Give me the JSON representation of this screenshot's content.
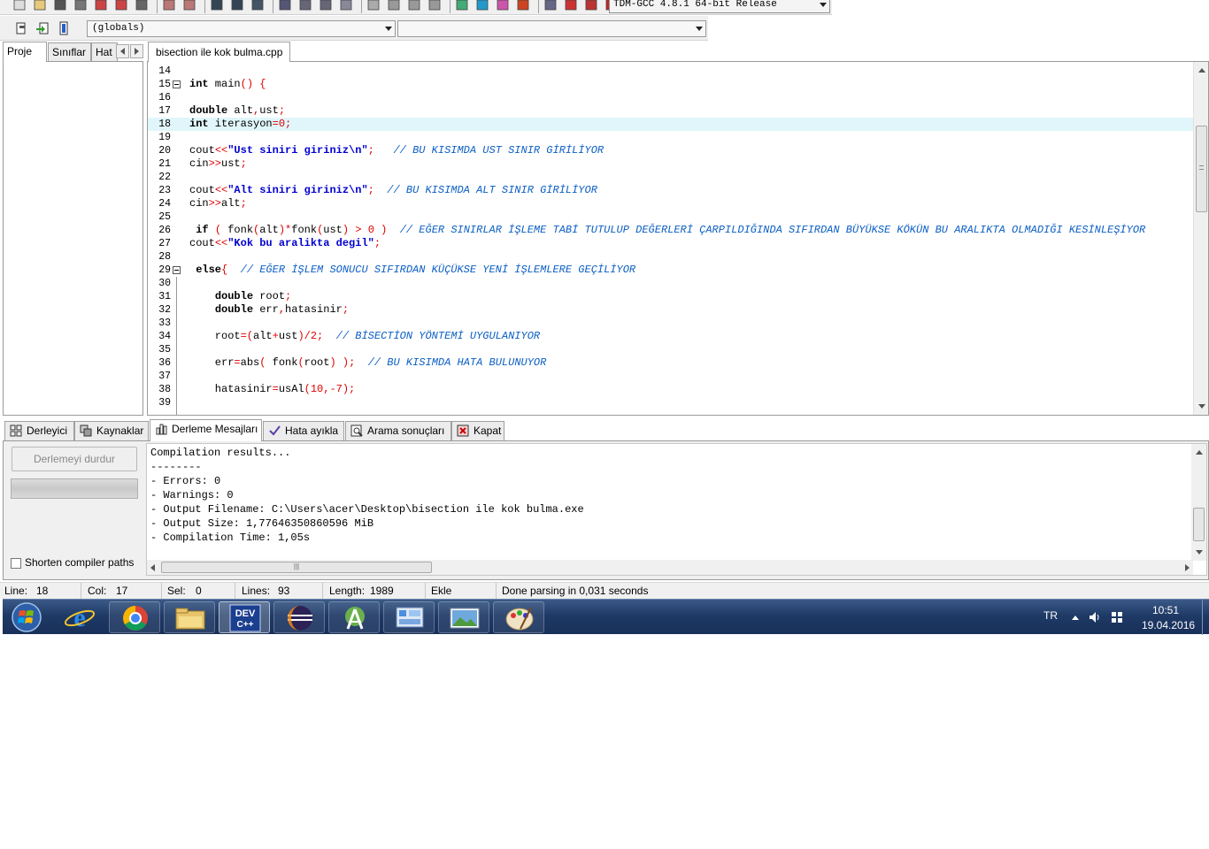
{
  "colors": {
    "keyword": "#000000",
    "operator": "#e00000",
    "string": "#0000d0",
    "comment": "#0b5fc4",
    "highlight_line": "#e0f6fb",
    "taskbar": "#1f3a66"
  },
  "toolbar": {
    "icons": [
      "new-file-icon",
      "open-icon",
      "save-icon",
      "save-all-icon",
      "close-icon",
      "close-all-icon",
      "print-icon",
      "undo-icon",
      "redo-icon",
      "find-icon",
      "replace-icon",
      "goto-icon",
      "bookmark-icon",
      "indent-icon",
      "unindent-icon",
      "toggle-comment-icon",
      "new-project-icon",
      "add-file-icon",
      "remove-file-icon",
      "project-options-icon",
      "compile-icon",
      "run-icon",
      "compile-run-icon",
      "rebuild-icon",
      "syntax-check-icon",
      "stop-icon",
      "profile-icon",
      "delete-profile-icon"
    ],
    "compiler_select": "TDM-GCC 4.8.1 64-bit Release",
    "scope_select": "(globals)",
    "function_select": ""
  },
  "left_panel": {
    "tabs": [
      {
        "label": "Proje",
        "active": true
      },
      {
        "label": "Sınıflar",
        "active": false
      },
      {
        "label": "Hat",
        "active": false
      }
    ]
  },
  "editor": {
    "file_tab": "bisection ile kok bulma.cpp",
    "lines": [
      {
        "n": "14",
        "code": []
      },
      {
        "n": "15",
        "fold": true,
        "code": [
          [
            "kw",
            "int"
          ],
          [
            "",
            " main"
          ],
          [
            "op",
            "() {"
          ]
        ]
      },
      {
        "n": "16",
        "code": []
      },
      {
        "n": "17",
        "code": [
          [
            "kw",
            "double"
          ],
          [
            "",
            " alt"
          ],
          [
            "op",
            ","
          ],
          [
            "",
            "ust"
          ],
          [
            "op",
            ";"
          ]
        ]
      },
      {
        "n": "18",
        "hl": true,
        "code": [
          [
            "kw",
            "int"
          ],
          [
            "",
            " iterasyon"
          ],
          [
            "op",
            "="
          ],
          [
            "num",
            "0"
          ],
          [
            "op",
            ";"
          ]
        ]
      },
      {
        "n": "19",
        "code": []
      },
      {
        "n": "20",
        "code": [
          [
            "",
            "cout"
          ],
          [
            "op",
            "<<"
          ],
          [
            "str",
            "\"Ust siniri giriniz\\n\""
          ],
          [
            "op",
            ";"
          ],
          [
            "",
            "   "
          ],
          [
            "cmt",
            "// BU KISIMDA UST SINIR GİRİLİYOR"
          ]
        ]
      },
      {
        "n": "21",
        "code": [
          [
            "",
            "cin"
          ],
          [
            "op",
            ">>"
          ],
          [
            "",
            "ust"
          ],
          [
            "op",
            ";"
          ]
        ]
      },
      {
        "n": "22",
        "code": []
      },
      {
        "n": "23",
        "code": [
          [
            "",
            "cout"
          ],
          [
            "op",
            "<<"
          ],
          [
            "str",
            "\"Alt siniri giriniz\\n\""
          ],
          [
            "op",
            ";"
          ],
          [
            "",
            "  "
          ],
          [
            "cmt",
            "// BU KISIMDA ALT SINIR GİRİLİYOR"
          ]
        ]
      },
      {
        "n": "24",
        "code": [
          [
            "",
            "cin"
          ],
          [
            "op",
            ">>"
          ],
          [
            "",
            "alt"
          ],
          [
            "op",
            ";"
          ]
        ]
      },
      {
        "n": "25",
        "code": []
      },
      {
        "n": "26",
        "code": [
          [
            "",
            ""
          ],
          [
            "kw",
            " if"
          ],
          [
            "",
            " "
          ],
          [
            "op",
            "("
          ],
          [
            "",
            " fonk"
          ],
          [
            "op",
            "("
          ],
          [
            "",
            "alt"
          ],
          [
            "op",
            ")*"
          ],
          [
            "",
            "fonk"
          ],
          [
            "op",
            "("
          ],
          [
            "",
            "ust"
          ],
          [
            "op",
            ")"
          ],
          [
            "",
            " "
          ],
          [
            "op",
            ">"
          ],
          [
            "",
            " "
          ],
          [
            "num",
            "0"
          ],
          [
            "",
            " "
          ],
          [
            "op",
            ")"
          ],
          [
            "",
            "  "
          ],
          [
            "cmt",
            "// EĞER SINIRLAR İŞLEME TABİ TUTULUP DEĞERLERİ ÇARPILDIĞINDA SIFIRDAN BÜYÜKSE KÖKÜN BU ARALIKTA OLMADIĞI KESİNLEŞİYOR"
          ]
        ]
      },
      {
        "n": "27",
        "code": [
          [
            "",
            "cout"
          ],
          [
            "op",
            "<<"
          ],
          [
            "str",
            "\"Kok bu aralikta degil\""
          ],
          [
            "op",
            ";"
          ]
        ]
      },
      {
        "n": "28",
        "code": []
      },
      {
        "n": "29",
        "fold": true,
        "code": [
          [
            "kw",
            " else"
          ],
          [
            "op",
            "{"
          ],
          [
            "",
            "  "
          ],
          [
            "cmt",
            "// EĞER İŞLEM SONUCU SIFIRDAN KÜÇÜKSE YENİ İŞLEMLERE GEÇİLİYOR"
          ]
        ]
      },
      {
        "n": "30",
        "code": []
      },
      {
        "n": "31",
        "code": [
          [
            "",
            "    "
          ],
          [
            "kw",
            "double"
          ],
          [
            "",
            " root"
          ],
          [
            "op",
            ";"
          ]
        ]
      },
      {
        "n": "32",
        "code": [
          [
            "",
            "    "
          ],
          [
            "kw",
            "double"
          ],
          [
            "",
            " err"
          ],
          [
            "op",
            ","
          ],
          [
            "",
            "hatasinir"
          ],
          [
            "op",
            ";"
          ]
        ]
      },
      {
        "n": "33",
        "code": []
      },
      {
        "n": "34",
        "code": [
          [
            "",
            "    root"
          ],
          [
            "op",
            "=("
          ],
          [
            "",
            "alt"
          ],
          [
            "op",
            "+"
          ],
          [
            "",
            "ust"
          ],
          [
            "op",
            ")/"
          ],
          [
            "num",
            "2"
          ],
          [
            "op",
            ";"
          ],
          [
            "",
            "  "
          ],
          [
            "cmt",
            "// BİSECTİON YÖNTEMİ UYGULANIYOR"
          ]
        ]
      },
      {
        "n": "35",
        "code": []
      },
      {
        "n": "36",
        "code": [
          [
            "",
            "    err"
          ],
          [
            "op",
            "="
          ],
          [
            "",
            "abs"
          ],
          [
            "op",
            "("
          ],
          [
            "",
            " fonk"
          ],
          [
            "op",
            "("
          ],
          [
            "",
            "root"
          ],
          [
            "op",
            ")"
          ],
          [
            "",
            " "
          ],
          [
            "op",
            ");"
          ],
          [
            "",
            "  "
          ],
          [
            "cmt",
            "// BU KISIMDA HATA BULUNUYOR"
          ]
        ]
      },
      {
        "n": "37",
        "code": []
      },
      {
        "n": "38",
        "code": [
          [
            "",
            "    hatasinir"
          ],
          [
            "op",
            "="
          ],
          [
            "",
            "usAl"
          ],
          [
            "op",
            "("
          ],
          [
            "num",
            "10"
          ],
          [
            "op",
            ",-"
          ],
          [
            "num",
            "7"
          ],
          [
            "op",
            ");"
          ]
        ]
      },
      {
        "n": "39",
        "code": []
      }
    ]
  },
  "bottom_tabs": [
    {
      "label": "Derleyici",
      "icon": "compiler-grid-icon",
      "active": false
    },
    {
      "label": "Kaynaklar",
      "icon": "resources-icon",
      "active": false
    },
    {
      "label": "Derleme Mesajları",
      "icon": "compile-log-chart-icon",
      "active": true
    },
    {
      "label": "Hata ayıkla",
      "icon": "debug-check-icon",
      "active": false
    },
    {
      "label": "Arama sonuçları",
      "icon": "search-results-icon",
      "active": false
    },
    {
      "label": "Kapat",
      "icon": "close-panel-icon",
      "active": false
    }
  ],
  "compile_panel": {
    "stop_button": "Derlemeyi durdur",
    "shorten_label": "Shorten compiler paths",
    "output": [
      "Compilation results...",
      "--------",
      "- Errors: 0",
      "- Warnings: 0",
      "- Output Filename: C:\\Users\\acer\\Desktop\\bisection ile kok bulma.exe",
      "- Output Size: 1,77646350860596 MiB",
      "- Compilation Time: 1,05s"
    ]
  },
  "status": {
    "line_label": "Line:",
    "line_value": "18",
    "col_label": "Col:",
    "col_value": "17",
    "sel_label": "Sel:",
    "sel_value": "0",
    "lines_label": "Lines:",
    "lines_value": "93",
    "length_label": "Length:",
    "length_value": "1989",
    "mode": "Ekle",
    "message": "Done parsing in 0,031 seconds"
  },
  "taskbar": {
    "apps": [
      {
        "name": "internet-explorer-icon",
        "active": false
      },
      {
        "name": "chrome-icon",
        "active": false
      },
      {
        "name": "file-explorer-icon",
        "active": false
      },
      {
        "name": "dev-cpp-icon",
        "active": true
      },
      {
        "name": "eclipse-icon",
        "active": false
      },
      {
        "name": "android-studio-icon",
        "active": false
      },
      {
        "name": "control-panel-icon",
        "active": false
      },
      {
        "name": "photo-viewer-icon",
        "active": false
      },
      {
        "name": "paint-icon",
        "active": false
      }
    ],
    "devcpp_label_top": "DEV",
    "devcpp_label_bottom": "C++",
    "language": "TR",
    "time": "10:51",
    "date": "19.04.2016"
  }
}
